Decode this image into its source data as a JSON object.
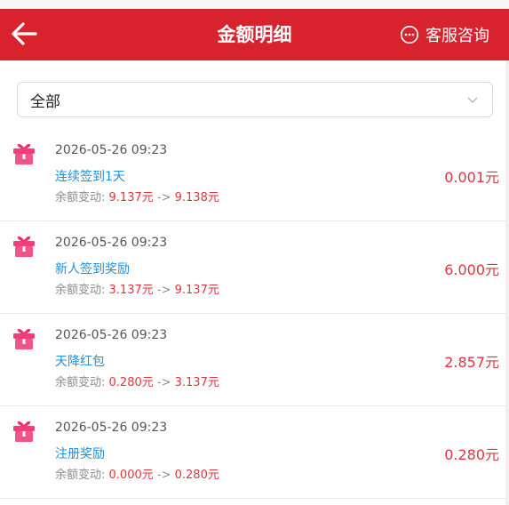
{
  "header": {
    "title": "金额明细",
    "service_label": "客服咨询"
  },
  "filter": {
    "selected": "全部"
  },
  "records": [
    {
      "time": "2026-05-26 09:23",
      "title": "连续签到1天",
      "change_label": "余额变动:",
      "before": "9.137元",
      "arrow": "->",
      "after": "9.138元",
      "amount": "0.001元"
    },
    {
      "time": "2026-05-26 09:23",
      "title": "新人签到奖励",
      "change_label": "余额变动:",
      "before": "3.137元",
      "arrow": "->",
      "after": "9.137元",
      "amount": "6.000元"
    },
    {
      "time": "2026-05-26 09:23",
      "title": "天降红包",
      "change_label": "余额变动:",
      "before": "0.280元",
      "arrow": "->",
      "after": "3.137元",
      "amount": "2.857元"
    },
    {
      "time": "2026-05-26 09:23",
      "title": "注册奖励",
      "change_label": "余额变动:",
      "before": "0.000元",
      "arrow": "->",
      "after": "0.280元",
      "amount": "0.280元"
    }
  ],
  "icons": {
    "back": "arrow-left-icon",
    "service": "chat-bubble-icon",
    "dropdown": "chevron-down-icon",
    "record": "gift-icon"
  },
  "colors": {
    "header_bg": "#d8232f",
    "title_link": "#1f8fdc",
    "amount_red": "#e0353f"
  }
}
